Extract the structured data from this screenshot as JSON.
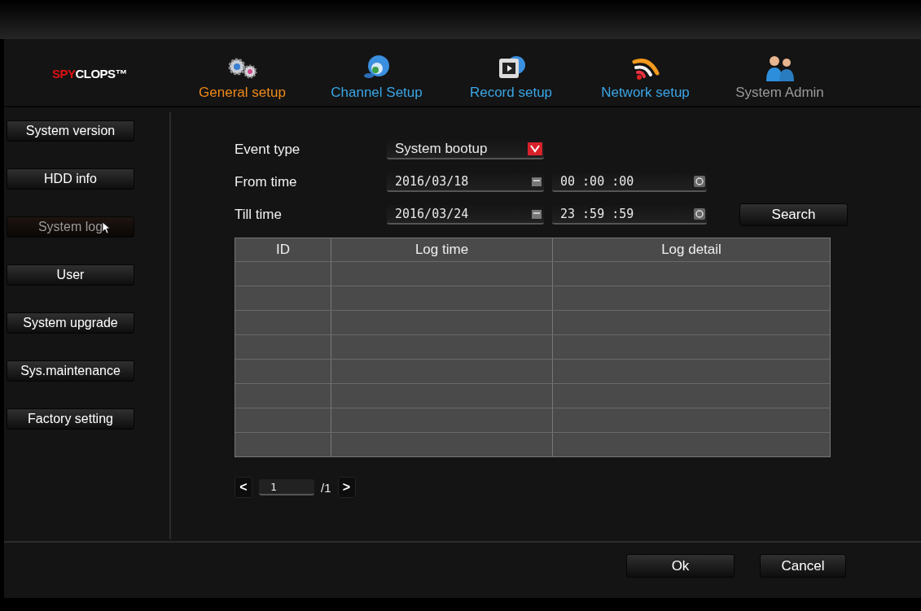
{
  "logo": {
    "accent": "SPY",
    "rest": "CLOPS™"
  },
  "tabs": [
    {
      "label": "General setup",
      "selected": true,
      "disabled": false
    },
    {
      "label": "Channel Setup",
      "selected": false,
      "disabled": false
    },
    {
      "label": "Record setup",
      "selected": false,
      "disabled": false
    },
    {
      "label": "Network setup",
      "selected": false,
      "disabled": false
    },
    {
      "label": "System Admin",
      "selected": false,
      "disabled": true
    }
  ],
  "sidebar": {
    "items": [
      {
        "label": "System version",
        "selected": false
      },
      {
        "label": "HDD info",
        "selected": false
      },
      {
        "label": "System log",
        "selected": true
      },
      {
        "label": "User",
        "selected": false
      },
      {
        "label": "System upgrade",
        "selected": false
      },
      {
        "label": "Sys.maintenance",
        "selected": false
      },
      {
        "label": "Factory setting",
        "selected": false
      }
    ]
  },
  "form": {
    "event_type": {
      "label": "Event type",
      "value": "System bootup"
    },
    "from_time": {
      "label": "From time",
      "date": "2016/03/18",
      "time": "00 :00 :00"
    },
    "till_time": {
      "label": "Till time",
      "date": "2016/03/24",
      "time": "23 :59 :59"
    },
    "search_button": "Search"
  },
  "table": {
    "columns": [
      "ID",
      "Log time",
      "Log detail"
    ]
  },
  "pager": {
    "prev": "<",
    "page": "1",
    "total": "/1",
    "next": ">"
  },
  "buttons": [
    "Ok",
    "Cancel"
  ]
}
